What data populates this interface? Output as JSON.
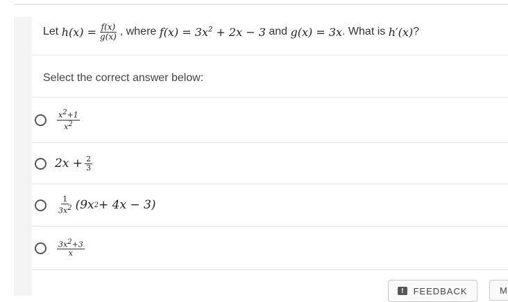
{
  "question": {
    "prefix": "Let",
    "h_def": "h(x) =",
    "f_over": "f(x)",
    "g_under": "g(x)",
    "where": ", where",
    "f_def": "f(x) = 3x",
    "f_exp": "2",
    "f_rest": " + 2x − 3",
    "and": "and",
    "g_def": "g(x) = 3x",
    "ask": ". What is",
    "hprime": "h′(x)",
    "qmark": "?"
  },
  "instruction": "Select the correct answer below:",
  "options": [
    {
      "num_base": "x",
      "num_exp": "2",
      "num_rest": "+1",
      "den_base": "x",
      "den_exp": "2"
    },
    {
      "lead": "2x +",
      "num": "2",
      "den": "3"
    },
    {
      "num": "1",
      "den_base": "3x",
      "den_exp": "2",
      "paren_a": "(9x",
      "paren_exp": "2",
      "paren_b": " + 4x − 3)"
    },
    {
      "num_base": "3x",
      "num_exp": "2",
      "num_rest": "+3",
      "den": "x"
    }
  ],
  "footer": {
    "feedback_label": "FEEDBACK",
    "feedback_icon": "!",
    "more_label": "M"
  }
}
